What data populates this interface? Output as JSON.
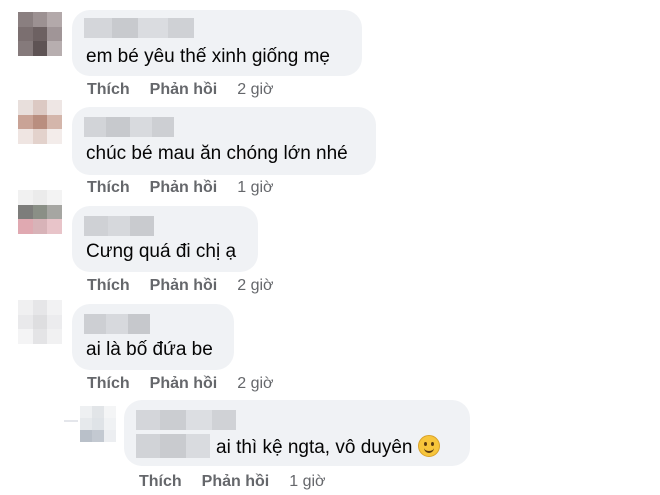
{
  "comments": [
    {
      "text": "em bé yêu thế xinh giống mẹ",
      "actions": {
        "like": "Thích",
        "reply": "Phản hồi",
        "time": "2 giờ"
      }
    },
    {
      "text": "chúc bé mau ăn chóng lớn nhé",
      "actions": {
        "like": "Thích",
        "reply": "Phản hồi",
        "time": "1 giờ"
      }
    },
    {
      "text": "Cưng quá đi chị ạ",
      "actions": {
        "like": "Thích",
        "reply": "Phản hồi",
        "time": "2 giờ"
      }
    },
    {
      "text": "ai là bố đứa be",
      "actions": {
        "like": "Thích",
        "reply": "Phản hồi",
        "time": "2 giờ"
      }
    }
  ],
  "reply": {
    "text": "ai thì kệ ngta, vô duyên",
    "emoji_icon": "slightly-smiling-face-icon",
    "actions": {
      "like": "Thích",
      "reply": "Phản hồi",
      "time": "1 giờ"
    }
  },
  "colors": {
    "bubble": "#f0f2f5",
    "action_text": "#65676b",
    "body_text": "#050505"
  }
}
